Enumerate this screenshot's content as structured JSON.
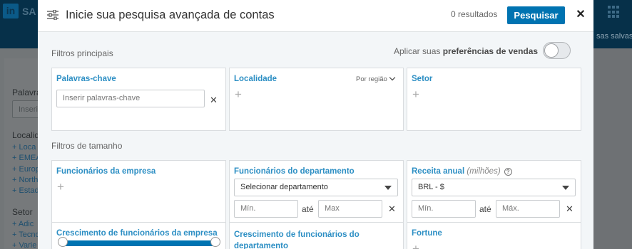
{
  "background": {
    "brand": "SA",
    "logo": "in",
    "saved_text": "sas salvas",
    "sidebar_labels": [
      "Palavra",
      "Localid",
      "Setor"
    ],
    "keyword_placeholder": "Inseri",
    "location_links": [
      "+ Loca",
      "+ EMEA",
      "+ Europ",
      "+ North",
      "+ Estad"
    ],
    "sector_links": [
      "+ Adic",
      "+ Tecno",
      "+ Varie"
    ]
  },
  "header": {
    "title": "Inicie sua pesquisa avançada de contas",
    "results": "0 resultados",
    "search_label": "Pesquisar",
    "close_label": "✕"
  },
  "main_filters": {
    "title": "Filtros principais",
    "preference_prefix": "Aplicar suas ",
    "preference_bold": "preferências de vendas",
    "keywords": {
      "label": "Palavras-chave",
      "placeholder": "Inserir palavras-chave"
    },
    "location": {
      "label": "Localidade",
      "region": "Por região"
    },
    "sector": {
      "label": "Setor"
    }
  },
  "size_filters": {
    "title": "Filtros de tamanho",
    "company_employees": {
      "label": "Funcionários da empresa"
    },
    "department_employees": {
      "label": "Funcionários do departamento",
      "select": "Selecionar departamento",
      "min": "Mín.",
      "to": "até",
      "max": "Max"
    },
    "annual_revenue": {
      "label": "Receita anual",
      "unit": "(milhões)",
      "help": "?",
      "currency": "BRL - $",
      "min": "Mín.",
      "to": "até",
      "max": "Máx."
    },
    "company_growth": {
      "label": "Crescimento de funcionários da empresa"
    },
    "department_growth": {
      "label_line1": "Crescimento de funcionários do",
      "label_line2": "departamento"
    },
    "fortune": {
      "label": "Fortune"
    }
  },
  "colors": {
    "accent": "#0073b1",
    "label": "#2d8fc4",
    "topbar": "#063049"
  }
}
